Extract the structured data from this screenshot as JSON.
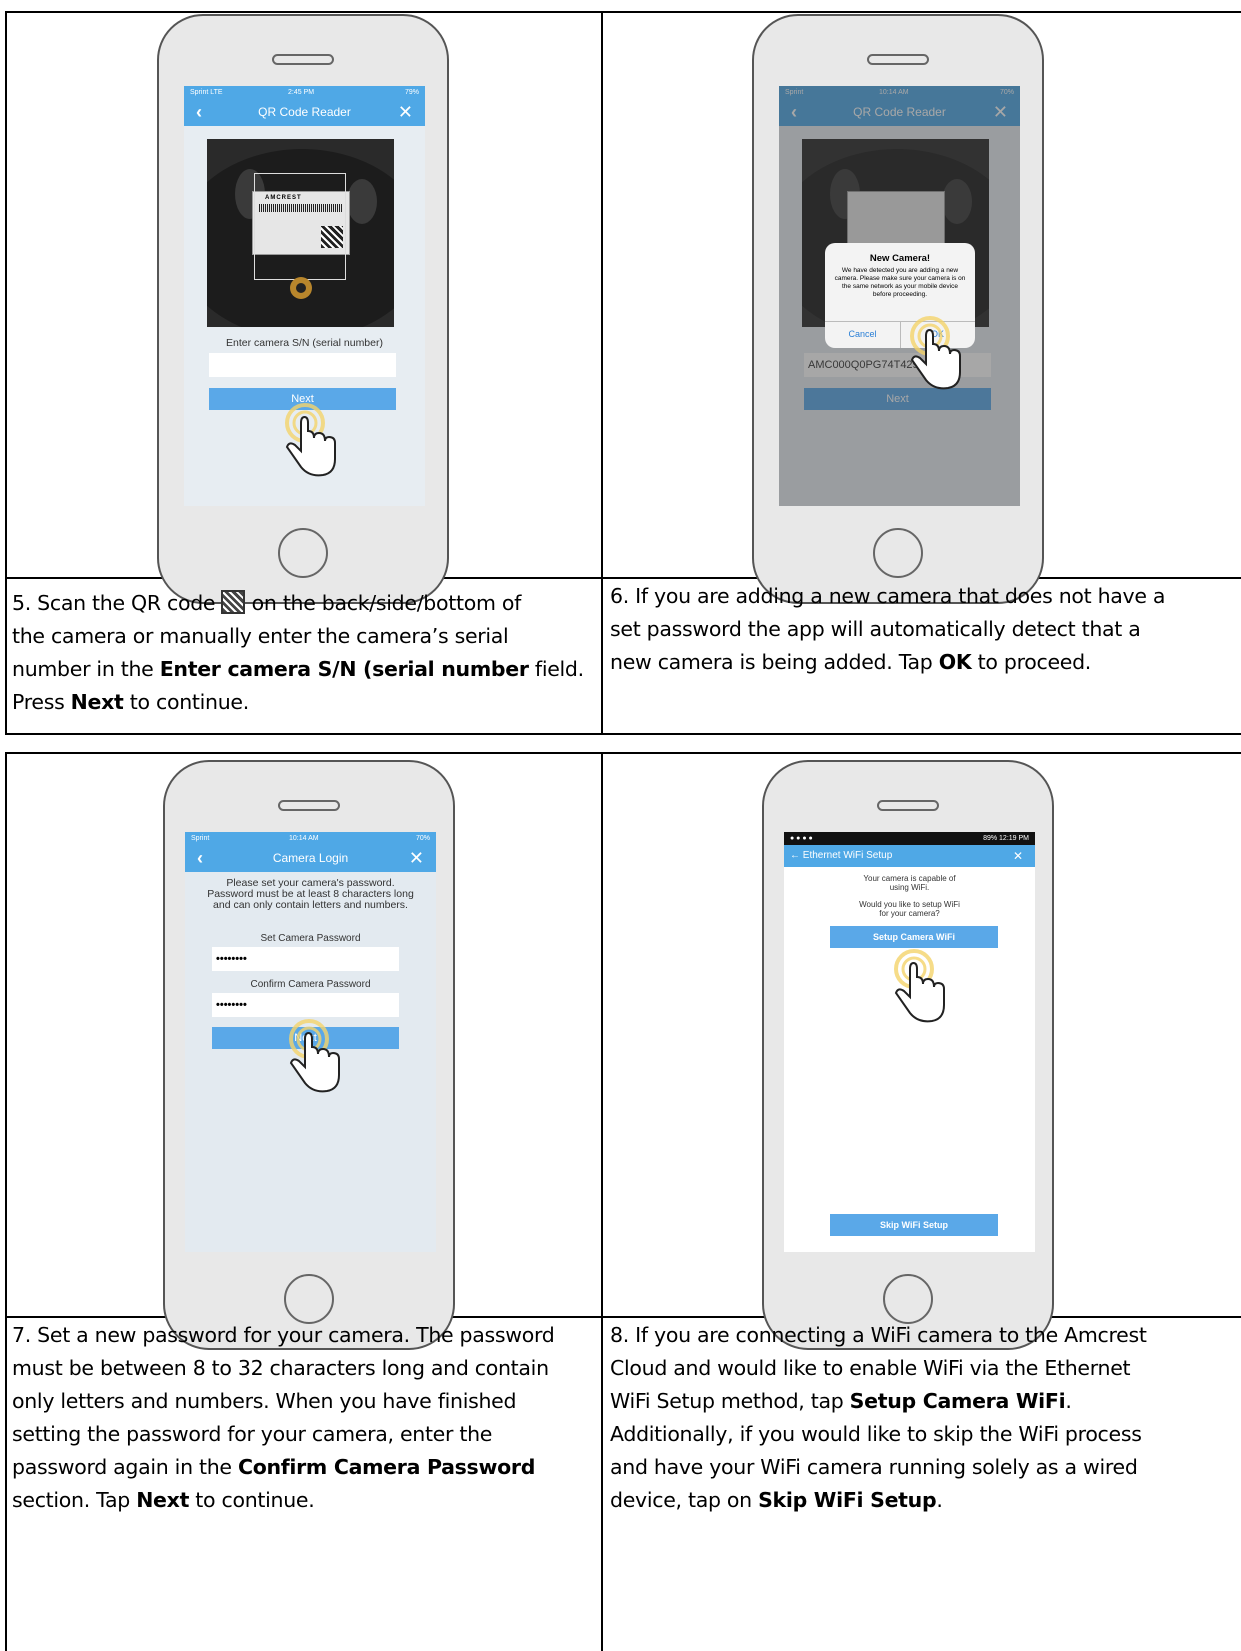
{
  "captions": {
    "step5": {
      "l1a": "5. Scan the QR code ",
      "l1b": " on the back/side/bottom of",
      "l2": "the camera or manually enter the camera’s serial",
      "l3a": "number in the ",
      "l3b": "Enter camera S/N (serial number",
      "l3c": " field.",
      "l4a": "Press ",
      "l4b": "Next",
      "l4c": " to continue."
    },
    "step6": {
      "l1": "6. If you are adding a new camera that does not have a",
      "l2": "set password the app will automatically detect that a",
      "l3a": "new camera is being added. Tap ",
      "l3b": "OK",
      "l3c": " to proceed."
    },
    "step7": {
      "l1": "7. Set a new password for your camera. The password",
      "l2": "must be between 8 to 32 characters long and contain",
      "l3": "only letters and numbers. When you have finished",
      "l4": "setting the password for your camera, enter the",
      "l5a": "password again in the ",
      "l5b": "Confirm Camera Password",
      "l6a": "section. Tap ",
      "l6b": "Next",
      "l6c": " to continue."
    },
    "step8": {
      "l1": "8. If you are connecting a WiFi camera to the Amcrest",
      "l2": "Cloud and would like to enable WiFi via the Ethernet",
      "l3a": "WiFi Setup method, tap ",
      "l3b": "Setup Camera WiFi",
      "l3c": ".",
      "l4": "Additionally, if you would like to skip the WiFi process",
      "l5": "and have your WiFi camera running solely as a wired",
      "l6a": "device, tap on ",
      "l6b": "Skip WiFi Setup",
      "l6c": "."
    }
  },
  "phone1": {
    "carrier": "Sprint LTE",
    "time": "2:45 PM",
    "battery": "79%",
    "title": "QR Code Reader",
    "brand": "AMCREST",
    "field_label": "Enter camera S/N (serial number)",
    "button": "Next"
  },
  "phone2": {
    "carrier": "Sprint",
    "time": "10:14 AM",
    "battery": "70%",
    "title": "QR Code Reader",
    "dialog_title": "New Camera!",
    "dialog_body": "We have detected you are adding a new camera. Please make sure your camera is on the same network as your mobile device before proceeding.",
    "cancel": "Cancel",
    "ok": "OK",
    "serial": "AMC000Q0PG74T4297",
    "button": "Next"
  },
  "phone3": {
    "carrier": "Sprint",
    "time": "10:14 AM",
    "battery": "70%",
    "title": "Camera Login",
    "intro": "Please set your camera's password. Password must be at least 8 characters long and can only contain letters and numbers.",
    "set_label": "Set Camera Password",
    "set_value": "••••••••",
    "confirm_label": "Confirm Camera Password",
    "confirm_value": "••••••••",
    "button": "Next"
  },
  "phone4": {
    "status_right": "89% 12:19 PM",
    "title": "Ethernet WiFi Setup",
    "msg1": "Your camera is capable of using WiFi.",
    "msg2": "Would you like to setup WiFi for your camera?",
    "setup_button": "Setup Camera WiFi",
    "skip_button": "Skip WiFi Setup"
  },
  "colors": {
    "accent": "#4fa8e6",
    "border": "#000000"
  }
}
